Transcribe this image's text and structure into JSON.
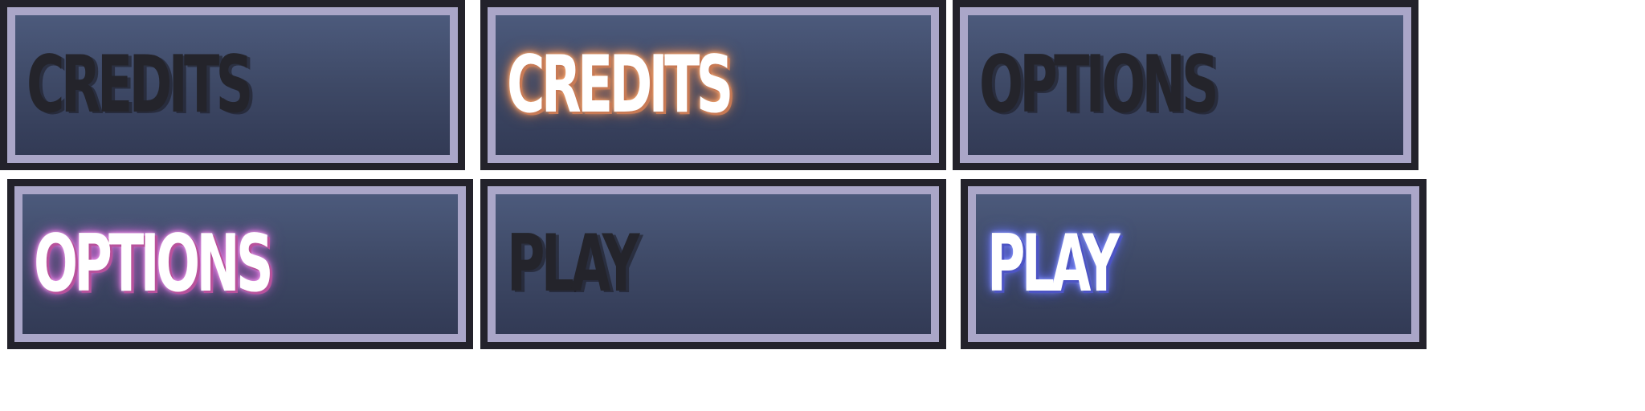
{
  "buttons": [
    {
      "label": "CREDITS",
      "state": "normal"
    },
    {
      "label": "CREDITS",
      "state": "hover",
      "glow_color": "#ff9a5a"
    },
    {
      "label": "OPTIONS",
      "state": "normal"
    },
    {
      "label": "OPTIONS",
      "state": "hover",
      "glow_color": "#e877e6"
    },
    {
      "label": "PLAY",
      "state": "normal"
    },
    {
      "label": "PLAY",
      "state": "hover",
      "glow_color": "#6f7dff"
    }
  ],
  "colors": {
    "outer_border": "#23222b",
    "inner_border": "#aaa6c8",
    "panel_top": "#4c5a7c",
    "panel_bottom": "#323a55",
    "dim_text": "#24242b",
    "lit_text": "#ffffff"
  }
}
